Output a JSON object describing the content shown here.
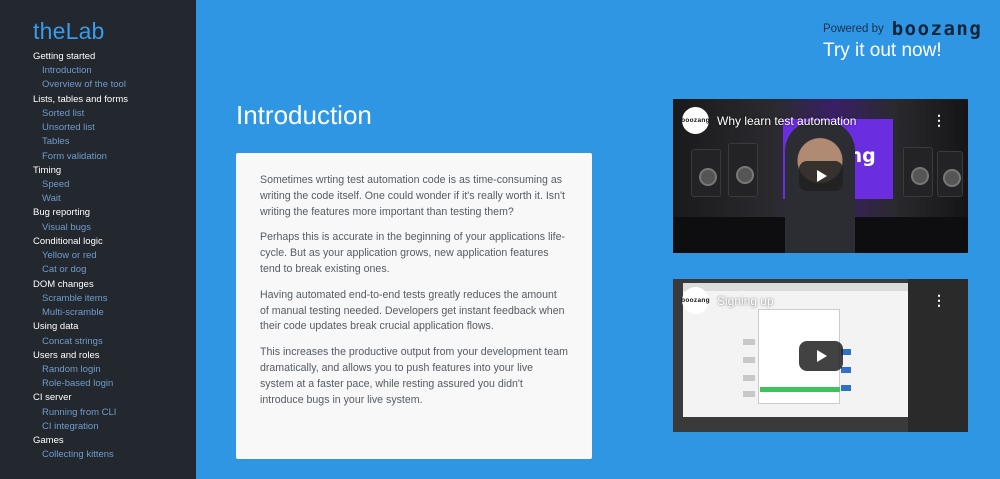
{
  "sidebar": {
    "brand": "theLab",
    "groups": [
      {
        "title": "Getting started",
        "items": [
          "Introduction",
          "Overview of the tool"
        ]
      },
      {
        "title": "Lists, tables and forms",
        "items": [
          "Sorted list",
          "Unsorted list",
          "Tables",
          "Form validation"
        ]
      },
      {
        "title": "Timing",
        "items": [
          "Speed",
          "Wait"
        ]
      },
      {
        "title": "Bug reporting",
        "items": [
          "Visual bugs"
        ]
      },
      {
        "title": "Conditional logic",
        "items": [
          "Yellow or red",
          "Cat or dog"
        ]
      },
      {
        "title": "DOM changes",
        "items": [
          "Scramble items",
          "Multi-scramble"
        ]
      },
      {
        "title": "Using data",
        "items": [
          "Concat strings"
        ]
      },
      {
        "title": "Users and roles",
        "items": [
          "Random login",
          "Role-based login"
        ]
      },
      {
        "title": "CI server",
        "items": [
          "Running from CLI",
          "CI integration"
        ]
      },
      {
        "title": "Games",
        "items": [
          "Collecting kittens"
        ]
      }
    ]
  },
  "header": {
    "powered_label": "Powered by",
    "logo_text": "boozang",
    "try_label": "Try it out now!"
  },
  "main": {
    "title": "Introduction",
    "paragraphs": [
      "Sometimes wrting test automation code is as time-consuming as writing the code itself. One could wonder if it's really worth it. Isn't writing the features more important than testing them?",
      "Perhaps this is accurate in the beginning of your applications life-cycle. But as your application grows, new application features tend to break existing ones.",
      "Having automated end-to-end tests greatly reduces the amount of manual testing needed. Developers get instant feedback when their code updates break crucial application flows.",
      "This increases the productive output from your development team dramatically, and allows you to push features into your live system at a faster pace, while resting assured you didn't introduce bugs in your live system."
    ]
  },
  "videos": [
    {
      "title": "Why learn test automation",
      "channel_avatar": "boozang",
      "screen_text": "boozang"
    },
    {
      "title": "Signing up",
      "channel_avatar": "boozang"
    }
  ],
  "colors": {
    "background": "#2f96e4",
    "sidebar": "#23272e",
    "brand": "#3a9bea",
    "sub_item": "#6f9ccc"
  }
}
